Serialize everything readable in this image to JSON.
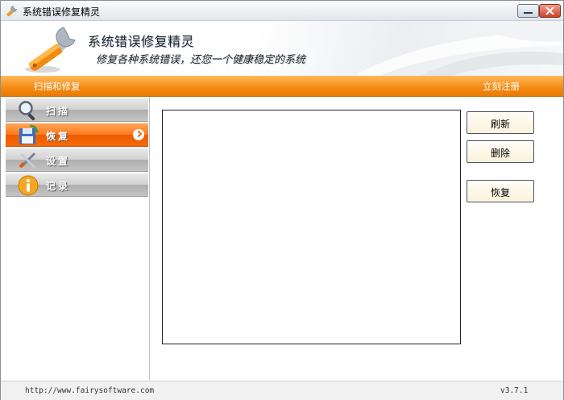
{
  "window": {
    "title": "系统错误修复精灵"
  },
  "header": {
    "app_title": "系统错误修复精灵",
    "subtitle": "修复各种系统错误，还您一个健康稳定的系统"
  },
  "menubar": {
    "scan_repair": "扫描和修复",
    "register_now": "立刻注册"
  },
  "sidebar": {
    "items": [
      {
        "label": "扫描",
        "icon": "magnifier-icon",
        "active": false
      },
      {
        "label": "恢复",
        "icon": "restore-disk-icon",
        "active": true
      },
      {
        "label": "设置",
        "icon": "tools-icon",
        "active": false
      },
      {
        "label": "记录",
        "icon": "info-icon",
        "active": false
      }
    ]
  },
  "main": {
    "buttons": {
      "refresh": "刷新",
      "delete": "删除",
      "restore": "恢复"
    }
  },
  "status": {
    "url": "http://www.fairysoftware.com",
    "version": "v3.7.1"
  },
  "colors": {
    "accent_orange": "#f48a12",
    "active_item": "#ff7a1a"
  }
}
